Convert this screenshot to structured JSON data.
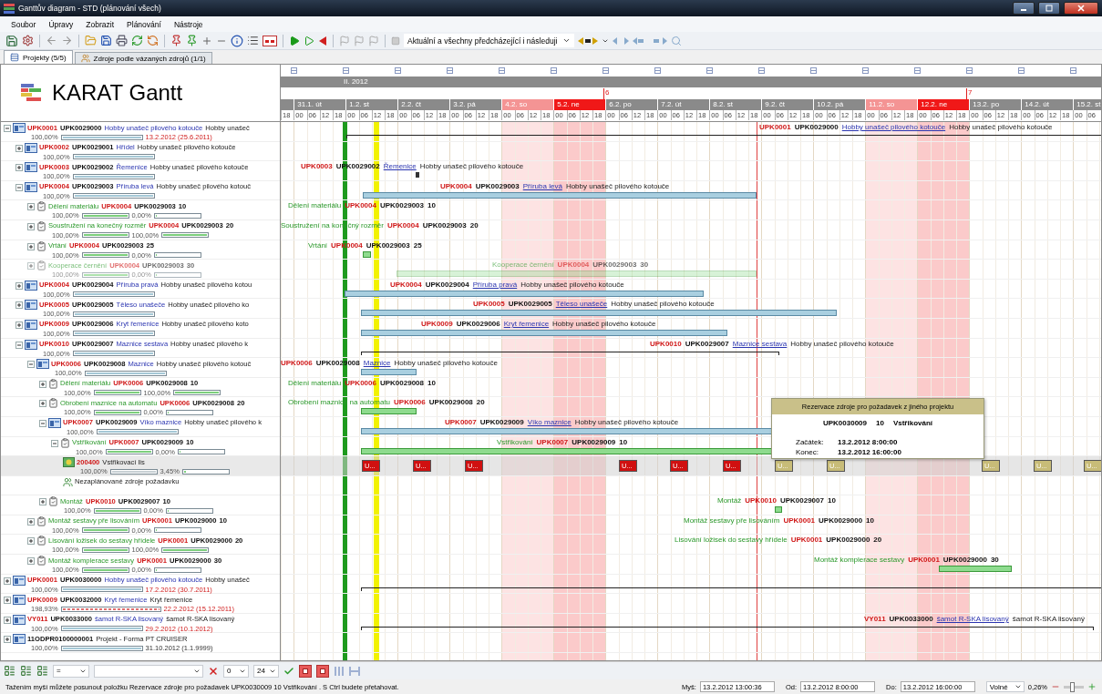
{
  "window": {
    "title": "Ganttův diagram - STD (plánování všech)"
  },
  "menu": [
    "Soubor",
    "Úpravy",
    "Zobrazit",
    "Plánování",
    "Nástroje"
  ],
  "toolbar": {
    "filter": "Aktuální a všechny předcházející i následuji"
  },
  "tabs": [
    {
      "label": "Projekty (5/5)",
      "selected": true
    },
    {
      "label": "Zdroje podle vázaných zdrojů (1/1)",
      "selected": false
    }
  ],
  "header": {
    "title": "KARAT Gantt"
  },
  "timeline": {
    "lead_hours": [
      "18"
    ],
    "month": {
      "label": "II. 2012"
    },
    "weeks": [
      {
        "label": "6"
      },
      {
        "label": "7"
      }
    ],
    "days": [
      {
        "label": "31.1. út",
        "kind": "work",
        "hours": [
          "00",
          "06",
          "12",
          "18"
        ]
      },
      {
        "label": "1.2. st",
        "kind": "work",
        "hours": [
          "00",
          "06",
          "12",
          "18"
        ]
      },
      {
        "label": "2.2. čt",
        "kind": "work",
        "hours": [
          "00",
          "06",
          "12",
          "18"
        ]
      },
      {
        "label": "3.2. pá",
        "kind": "work",
        "hours": [
          "00",
          "06",
          "12",
          "18"
        ]
      },
      {
        "label": "4.2. so",
        "kind": "saturday",
        "hours": [
          "00",
          "06",
          "12",
          "18"
        ]
      },
      {
        "label": "5.2. ne",
        "kind": "sunday",
        "hours": [
          "00",
          "06",
          "12",
          "18"
        ]
      },
      {
        "label": "6.2. po",
        "kind": "work",
        "hours": [
          "00",
          "06",
          "12",
          "18"
        ]
      },
      {
        "label": "7.2. út",
        "kind": "work",
        "hours": [
          "00",
          "06",
          "12",
          "18"
        ]
      },
      {
        "label": "8.2. st",
        "kind": "work",
        "hours": [
          "00",
          "06",
          "12",
          "18"
        ]
      },
      {
        "label": "9.2. čt",
        "kind": "work",
        "hours": [
          "00",
          "06",
          "12",
          "18"
        ]
      },
      {
        "label": "10.2. pá",
        "kind": "work",
        "hours": [
          "00",
          "06",
          "12",
          "18"
        ]
      },
      {
        "label": "11.2. so",
        "kind": "saturday",
        "hours": [
          "00",
          "06",
          "12",
          "18"
        ]
      },
      {
        "label": "12.2. ne",
        "kind": "sunday",
        "hours": [
          "00",
          "06",
          "12",
          "18"
        ]
      },
      {
        "label": "13.2. po",
        "kind": "work",
        "hours": [
          "00",
          "06",
          "12",
          "18"
        ]
      },
      {
        "label": "14.2. út",
        "kind": "work",
        "hours": [
          "00",
          "06",
          "12",
          "18"
        ]
      },
      {
        "label": "15.2. st",
        "kind": "work",
        "hours": [
          "00",
          "06"
        ]
      }
    ],
    "markers": [
      {
        "color": "#1e9a1e"
      },
      {
        "color": "#f2f200"
      },
      {
        "color": "#e04040"
      }
    ]
  },
  "tree": [
    {
      "kind": "project",
      "expanded": true,
      "parts": [
        {
          "kind": "code",
          "text": "UPK0001"
        },
        {
          "kind": "order",
          "text": "UPK0029000"
        },
        {
          "kind": "name",
          "text": "Hobby unašeč pilového kotouče"
        },
        {
          "kind": "desc",
          "text": "Hobby unašeč"
        }
      ],
      "progress": [
        {
          "reading": "100,00%",
          "level": 1
        }
      ],
      "date": "13.2.2012 (25.6.2011)",
      "overdue": true,
      "gantt": {
        "label": [
          {
            "kind": "code",
            "text": "UPK0001"
          },
          {
            "kind": "order",
            "text": "UPK0029000"
          },
          {
            "kind": "name",
            "text": "Hobby unašeč pilového kotouče"
          },
          {
            "kind": "desc",
            "text": "Hobby unašeč pilového kotouče"
          }
        ],
        "bar": {
          "kind": "summary"
        }
      },
      "children": [
        {
          "kind": "project",
          "expanded": false,
          "parts": [
            {
              "kind": "code",
              "text": "UPK0002"
            },
            {
              "kind": "order",
              "text": "UPK0029001"
            },
            {
              "kind": "name",
              "text": "Hřídel"
            },
            {
              "kind": "desc",
              "text": "Hobby unašeč pilového kotouče"
            }
          ],
          "progress": [
            {
              "reading": "100,00%",
              "level": 1
            }
          ]
        },
        {
          "kind": "project",
          "expanded": false,
          "parts": [
            {
              "kind": "code",
              "text": "UPK0003"
            },
            {
              "kind": "order",
              "text": "UPK0029002"
            },
            {
              "kind": "name",
              "text": "Řemenice"
            },
            {
              "kind": "desc",
              "text": "Hobby unašeč pilového kotouče"
            }
          ],
          "progress": [
            {
              "reading": "100,00%",
              "level": 1
            }
          ],
          "gantt": {
            "label": [
              {
                "kind": "code",
                "text": "UPK0003"
              },
              {
                "kind": "order",
                "text": "UPK0029002"
              },
              {
                "kind": "name",
                "text": "Řemenice"
              },
              {
                "kind": "desc",
                "text": "Hobby unašeč pilového kotouče"
              }
            ],
            "bar": {
              "kind": "tick"
            }
          }
        },
        {
          "kind": "project",
          "expanded": true,
          "parts": [
            {
              "kind": "code",
              "text": "UPK0004"
            },
            {
              "kind": "order",
              "text": "UPK0029003"
            },
            {
              "kind": "name",
              "text": "Příruba levá"
            },
            {
              "kind": "desc",
              "text": "Hobby unašeč pilového kotouč"
            }
          ],
          "progress": [
            {
              "reading": "100,00%",
              "level": 1
            }
          ],
          "gantt": {
            "label": [
              {
                "kind": "code",
                "text": "UPK0004"
              },
              {
                "kind": "order",
                "text": "UPK0029003"
              },
              {
                "kind": "name",
                "text": "Příruba levá"
              },
              {
                "kind": "desc",
                "text": "Hobby unašeč pilového kotouče"
              }
            ],
            "bar": {
              "kind": "project"
            }
          },
          "children": [
            {
              "kind": "operation",
              "expanded": false,
              "disabled": false,
              "parts": [
                {
                  "kind": "op",
                  "text": "Dělení materiálu"
                },
                {
                  "kind": "code",
                  "text": "UPK0004"
                },
                {
                  "kind": "order",
                  "text": "UPK0029003"
                },
                {
                  "kind": "step",
                  "text": "10"
                }
              ],
              "progress": [
                {
                  "reading": "100,00%",
                  "level": 1
                },
                {
                  "reading": "0,00%",
                  "level": 0
                }
              ],
              "gantt": {
                "label": [
                  {
                    "kind": "op",
                    "text": "Dělení materiálu"
                  },
                  {
                    "kind": "code",
                    "text": "UPK0004"
                  },
                  {
                    "kind": "order",
                    "text": "UPK0029003"
                  },
                  {
                    "kind": "step",
                    "text": "10"
                  }
                ]
              }
            },
            {
              "kind": "operation",
              "expanded": false,
              "disabled": false,
              "parts": [
                {
                  "kind": "op",
                  "text": "Soustružení na konečný rozměr"
                },
                {
                  "kind": "code",
                  "text": "UPK0004"
                },
                {
                  "kind": "order",
                  "text": "UPK0029003"
                },
                {
                  "kind": "step",
                  "text": "20"
                }
              ],
              "progress": [
                {
                  "reading": "100,00%",
                  "level": 1
                },
                {
                  "reading": "100,00%",
                  "level": 1
                }
              ],
              "gantt": {
                "label": [
                  {
                    "kind": "op",
                    "text": "Soustružení na konečný rozměr"
                  },
                  {
                    "kind": "code",
                    "text": "UPK0004"
                  },
                  {
                    "kind": "order",
                    "text": "UPK0029003"
                  },
                  {
                    "kind": "step",
                    "text": "20"
                  }
                ]
              }
            },
            {
              "kind": "operation",
              "expanded": false,
              "disabled": false,
              "parts": [
                {
                  "kind": "op",
                  "text": "Vrtání"
                },
                {
                  "kind": "code",
                  "text": "UPK0004"
                },
                {
                  "kind": "order",
                  "text": "UPK0029003"
                },
                {
                  "kind": "step",
                  "text": "25"
                }
              ],
              "progress": [
                {
                  "reading": "100,00%",
                  "level": 1
                },
                {
                  "reading": "0,00%",
                  "level": 0
                }
              ],
              "gantt": {
                "label": [
                  {
                    "kind": "op",
                    "text": "Vrtání"
                  },
                  {
                    "kind": "code",
                    "text": "UPK0004"
                  },
                  {
                    "kind": "order",
                    "text": "UPK0029003"
                  },
                  {
                    "kind": "step",
                    "text": "25"
                  }
                ],
                "bar": {
                  "kind": "operation"
                }
              }
            },
            {
              "kind": "operation",
              "expanded": false,
              "disabled": true,
              "parts": [
                {
                  "kind": "op",
                  "text": "Kooperace černění"
                },
                {
                  "kind": "code",
                  "text": "UPK0004"
                },
                {
                  "kind": "order",
                  "text": "UPK0029003"
                },
                {
                  "kind": "step",
                  "text": "30"
                }
              ],
              "progress": [
                {
                  "reading": "100,00%",
                  "level": 1
                },
                {
                  "reading": "0,00%",
                  "level": 0
                }
              ],
              "gantt": {
                "label": [
                  {
                    "kind": "op",
                    "text": "Kooperace černění"
                  },
                  {
                    "kind": "code",
                    "text": "UPK0004"
                  },
                  {
                    "kind": "order",
                    "text": "UPK0029003"
                  },
                  {
                    "kind": "step",
                    "text": "30"
                  }
                ],
                "bar": {
                  "kind": "operation"
                }
              }
            }
          ]
        },
        {
          "kind": "project",
          "expanded": false,
          "parts": [
            {
              "kind": "code",
              "text": "UPK0004"
            },
            {
              "kind": "order",
              "text": "UPK0029004"
            },
            {
              "kind": "name",
              "text": "Příruba pravá"
            },
            {
              "kind": "desc",
              "text": "Hobby unašeč pilového kotou"
            }
          ],
          "progress": [
            {
              "reading": "100,00%",
              "level": 1
            }
          ],
          "gantt": {
            "label": [
              {
                "kind": "code",
                "text": "UPK0004"
              },
              {
                "kind": "order",
                "text": "UPK0029004"
              },
              {
                "kind": "name",
                "text": "Příruba pravá"
              },
              {
                "kind": "desc",
                "text": "Hobby unašeč pilového kotouče"
              }
            ],
            "bar": {
              "kind": "project"
            }
          }
        },
        {
          "kind": "project",
          "expanded": false,
          "parts": [
            {
              "kind": "code",
              "text": "UPK0005"
            },
            {
              "kind": "order",
              "text": "UPK0029005"
            },
            {
              "kind": "name",
              "text": "Těleso unašeče"
            },
            {
              "kind": "desc",
              "text": "Hobby unašeč pilového ko"
            }
          ],
          "progress": [
            {
              "reading": "100,00%",
              "level": 1
            }
          ],
          "gantt": {
            "label": [
              {
                "kind": "code",
                "text": "UPK0005"
              },
              {
                "kind": "order",
                "text": "UPK0029005"
              },
              {
                "kind": "name",
                "text": "Těleso unašeče"
              },
              {
                "kind": "desc",
                "text": "Hobby unašeč pilového kotouče"
              }
            ],
            "bar": {
              "kind": "project"
            }
          }
        },
        {
          "kind": "project",
          "expanded": false,
          "parts": [
            {
              "kind": "code",
              "text": "UPK0009"
            },
            {
              "kind": "order",
              "text": "UPK0029006"
            },
            {
              "kind": "name",
              "text": "Kryt řemenice"
            },
            {
              "kind": "desc",
              "text": "Hobby unašeč pilového koto"
            }
          ],
          "progress": [
            {
              "reading": "100,00%",
              "level": 1
            }
          ],
          "gantt": {
            "label": [
              {
                "kind": "code",
                "text": "UPK0009"
              },
              {
                "kind": "order",
                "text": "UPK0029006"
              },
              {
                "kind": "name",
                "text": "Kryt řemenice"
              },
              {
                "kind": "desc",
                "text": "Hobby unašeč pilového kotouče"
              }
            ],
            "bar": {
              "kind": "project"
            }
          }
        },
        {
          "kind": "project",
          "expanded": true,
          "parts": [
            {
              "kind": "code",
              "text": "UPK0010"
            },
            {
              "kind": "order",
              "text": "UPK0029007"
            },
            {
              "kind": "name",
              "text": "Maznice sestava"
            },
            {
              "kind": "desc",
              "text": "Hobby unašeč pilového k"
            }
          ],
          "progress": [
            {
              "reading": "100,00%",
              "level": 1
            }
          ],
          "gantt": {
            "label": [
              {
                "kind": "code",
                "text": "UPK0010"
              },
              {
                "kind": "order",
                "text": "UPK0029007"
              },
              {
                "kind": "name",
                "text": "Maznice sestava"
              },
              {
                "kind": "desc",
                "text": "Hobby unašeč pilového kotouče"
              }
            ],
            "bar": {
              "kind": "summary"
            }
          },
          "children": [
            {
              "kind": "project",
              "expanded": true,
              "parts": [
                {
                  "kind": "code",
                  "text": "UPK0006"
                },
                {
                  "kind": "order",
                  "text": "UPK0029008"
                },
                {
                  "kind": "name",
                  "text": "Maznice"
                },
                {
                  "kind": "desc",
                  "text": "Hobby unašeč pilového kotouč"
                }
              ],
              "progress": [
                {
                  "reading": "100,00%",
                  "level": 1
                }
              ],
              "gantt": {
                "label": [
                  {
                    "kind": "code",
                    "text": "UPK0006"
                  },
                  {
                    "kind": "order",
                    "text": "UPK0029008"
                  },
                  {
                    "kind": "name",
                    "text": "Maznice"
                  },
                  {
                    "kind": "desc",
                    "text": "Hobby unašeč pilového kotouče"
                  }
                ],
                "bar": {
                  "kind": "project"
                }
              },
              "children": [
                {
                  "kind": "operation",
                  "expanded": false,
                  "disabled": false,
                  "parts": [
                    {
                      "kind": "op",
                      "text": "Dělení materiálu"
                    },
                    {
                      "kind": "code",
                      "text": "UPK0006"
                    },
                    {
                      "kind": "order",
                      "text": "UPK0029008"
                    },
                    {
                      "kind": "step",
                      "text": "10"
                    }
                  ],
                  "progress": [
                    {
                      "reading": "100,00%",
                      "level": 1
                    },
                    {
                      "reading": "100,00%",
                      "level": 1
                    }
                  ],
                  "gantt": {
                    "label": [
                      {
                        "kind": "op",
                        "text": "Dělení materiálu"
                      },
                      {
                        "kind": "code",
                        "text": "UPK0006"
                      },
                      {
                        "kind": "order",
                        "text": "UPK0029008"
                      },
                      {
                        "kind": "step",
                        "text": "10"
                      }
                    ]
                  }
                },
                {
                  "kind": "operation",
                  "expanded": false,
                  "disabled": false,
                  "parts": [
                    {
                      "kind": "op",
                      "text": "Obrobení maznice na automatu"
                    },
                    {
                      "kind": "code",
                      "text": "UPK0006"
                    },
                    {
                      "kind": "order",
                      "text": "UPK0029008"
                    },
                    {
                      "kind": "step",
                      "text": "20"
                    }
                  ],
                  "progress": [
                    {
                      "reading": "100,00%",
                      "level": 1
                    },
                    {
                      "reading": "0,00%",
                      "level": 0
                    }
                  ],
                  "gantt": {
                    "label": [
                      {
                        "kind": "op",
                        "text": "Obrobení maznice na automatu"
                      },
                      {
                        "kind": "code",
                        "text": "UPK0006"
                      },
                      {
                        "kind": "order",
                        "text": "UPK0029008"
                      },
                      {
                        "kind": "step",
                        "text": "20"
                      }
                    ],
                    "bar": {
                      "kind": "operation"
                    }
                  }
                },
                {
                  "kind": "project",
                  "expanded": true,
                  "parts": [
                    {
                      "kind": "code",
                      "text": "UPK0007"
                    },
                    {
                      "kind": "order",
                      "text": "UPK0029009"
                    },
                    {
                      "kind": "name",
                      "text": "Víko maznice"
                    },
                    {
                      "kind": "desc",
                      "text": "Hobby unašeč pilového k"
                    }
                  ],
                  "progress": [
                    {
                      "reading": "100,00%",
                      "level": 1
                    }
                  ],
                  "gantt": {
                    "label": [
                      {
                        "kind": "code",
                        "text": "UPK0007"
                      },
                      {
                        "kind": "order",
                        "text": "UPK0029009"
                      },
                      {
                        "kind": "name",
                        "text": "Víko maznice"
                      },
                      {
                        "kind": "desc",
                        "text": "Hobby unašeč pilového kotouče"
                      }
                    ],
                    "bar": {
                      "kind": "project"
                    }
                  },
                  "children": [
                    {
                      "kind": "operation",
                      "expanded": true,
                      "disabled": false,
                      "parts": [
                        {
                          "kind": "op",
                          "text": "Vstřikování"
                        },
                        {
                          "kind": "code",
                          "text": "UPK0007"
                        },
                        {
                          "kind": "order",
                          "text": "UPK0029009"
                        },
                        {
                          "kind": "step",
                          "text": "10"
                        }
                      ],
                      "progress": [
                        {
                          "reading": "100,00%",
                          "level": 1
                        },
                        {
                          "reading": "0,00%",
                          "level": 0
                        }
                      ],
                      "gantt": {
                        "label": [
                          {
                            "kind": "op",
                            "text": "Vstřikování"
                          },
                          {
                            "kind": "code",
                            "text": "UPK0007"
                          },
                          {
                            "kind": "order",
                            "text": "UPK0029009"
                          },
                          {
                            "kind": "step",
                            "text": "10"
                          }
                        ],
                        "bar": {
                          "kind": "operation"
                        }
                      },
                      "children": [
                        {
                          "kind": "resource",
                          "parts": [
                            {
                              "kind": "code",
                              "text": "200400"
                            },
                            {
                              "kind": "desc",
                              "text": "Vstřikovací lis"
                            }
                          ],
                          "progress": [
                            {
                              "reading": "100,00%",
                              "level": 1
                            },
                            {
                              "reading": "3,45%",
                              "level": 0.0345
                            }
                          ],
                          "gantt": {
                            "blocks": [
                              {
                                "label": "U...",
                                "color": "#d01010"
                              },
                              {
                                "label": "U...",
                                "color": "#d01010"
                              },
                              {
                                "label": "U...",
                                "color": "#d01010"
                              },
                              {
                                "label": "U...",
                                "color": "#d01010"
                              },
                              {
                                "label": "U...",
                                "color": "#d01010"
                              },
                              {
                                "label": "U...",
                                "color": "#d01010"
                              },
                              {
                                "label": "U...",
                                "color": "#c8bc78"
                              },
                              {
                                "label": "U...",
                                "color": "#c8bc78"
                              },
                              {
                                "label": "U...",
                                "color": "#c8bc78"
                              },
                              {
                                "label": "U...",
                                "color": "#c8bc78"
                              },
                              {
                                "label": "U...",
                                "color": "#c8bc78"
                              }
                            ]
                          }
                        },
                        {
                          "kind": "unplanned",
                          "parts": [
                            {
                              "kind": "desc",
                              "text": "Nezaplánované zdroje požadavku"
                            }
                          ]
                        }
                      ]
                    }
                  ]
                },
                {
                  "kind": "operation",
                  "expanded": false,
                  "disabled": false,
                  "parts": [
                    {
                      "kind": "op",
                      "text": "Montáž"
                    },
                    {
                      "kind": "code",
                      "text": "UPK0010"
                    },
                    {
                      "kind": "order",
                      "text": "UPK0029007"
                    },
                    {
                      "kind": "step",
                      "text": "10"
                    }
                  ],
                  "progress": [
                    {
                      "reading": "100,00%",
                      "level": 1
                    },
                    {
                      "reading": "0,00%",
                      "level": 0
                    }
                  ],
                  "gantt": {
                    "label": [
                      {
                        "kind": "op",
                        "text": "Montáž"
                      },
                      {
                        "kind": "code",
                        "text": "UPK0010"
                      },
                      {
                        "kind": "order",
                        "text": "UPK0029007"
                      },
                      {
                        "kind": "step",
                        "text": "10"
                      }
                    ],
                    "bar": {
                      "kind": "operation"
                    }
                  }
                }
              ]
            },
            {
              "kind": "operation",
              "expanded": false,
              "disabled": false,
              "parts": [
                {
                  "kind": "op",
                  "text": "Montáž sestavy pře lisováním"
                },
                {
                  "kind": "code",
                  "text": "UPK0001"
                },
                {
                  "kind": "order",
                  "text": "UPK0029000"
                },
                {
                  "kind": "step",
                  "text": "10"
                }
              ],
              "progress": [
                {
                  "reading": "100,00%",
                  "level": 1
                },
                {
                  "reading": "0,00%",
                  "level": 0
                }
              ],
              "gantt": {
                "label": [
                  {
                    "kind": "op",
                    "text": "Montáž sestavy pře lisováním"
                  },
                  {
                    "kind": "code",
                    "text": "UPK0001"
                  },
                  {
                    "kind": "order",
                    "text": "UPK0029000"
                  },
                  {
                    "kind": "step",
                    "text": "10"
                  }
                ]
              }
            },
            {
              "kind": "operation",
              "expanded": false,
              "disabled": false,
              "parts": [
                {
                  "kind": "op",
                  "text": "Lisování ložisek do sestavy hřídele"
                },
                {
                  "kind": "code",
                  "text": "UPK0001"
                },
                {
                  "kind": "order",
                  "text": "UPK0029000"
                },
                {
                  "kind": "step",
                  "text": "20"
                }
              ],
              "progress": [
                {
                  "reading": "100,00%",
                  "level": 1
                },
                {
                  "reading": "100,00%",
                  "level": 1
                }
              ],
              "gantt": {
                "label": [
                  {
                    "kind": "op",
                    "text": "Lisování ložisek do sestavy hřídele"
                  },
                  {
                    "kind": "code",
                    "text": "UPK0001"
                  },
                  {
                    "kind": "order",
                    "text": "UPK0029000"
                  },
                  {
                    "kind": "step",
                    "text": "20"
                  }
                ]
              }
            },
            {
              "kind": "operation",
              "expanded": false,
              "disabled": false,
              "parts": [
                {
                  "kind": "op",
                  "text": "Montáž komplerace sestavy"
                },
                {
                  "kind": "code",
                  "text": "UPK0001"
                },
                {
                  "kind": "order",
                  "text": "UPK0029000"
                },
                {
                  "kind": "step",
                  "text": "30"
                }
              ],
              "progress": [
                {
                  "reading": "100,00%",
                  "level": 1
                },
                {
                  "reading": "0,00%",
                  "level": 0
                }
              ],
              "gantt": {
                "label": [
                  {
                    "kind": "op",
                    "text": "Montáž komplerace sestavy"
                  },
                  {
                    "kind": "code",
                    "text": "UPK0001"
                  },
                  {
                    "kind": "order",
                    "text": "UPK0029000"
                  },
                  {
                    "kind": "step",
                    "text": "30"
                  }
                ],
                "bar": {
                  "kind": "operation"
                }
              }
            }
          ]
        }
      ]
    },
    {
      "kind": "project",
      "expanded": false,
      "parts": [
        {
          "kind": "code",
          "text": "UPK0001"
        },
        {
          "kind": "order",
          "text": "UPK0030000"
        },
        {
          "kind": "name",
          "text": "Hobby unašeč pilového kotouče"
        },
        {
          "kind": "desc",
          "text": "Hobby unašeč"
        }
      ],
      "progress": [
        {
          "reading": "100,00%",
          "level": 1
        }
      ],
      "date": "17.2.2012 (30.7.2011)",
      "overdue": true,
      "gantt": {
        "bar": {
          "kind": "summary"
        }
      }
    },
    {
      "kind": "project",
      "expanded": false,
      "parts": [
        {
          "kind": "code",
          "text": "UPK0009"
        },
        {
          "kind": "order",
          "text": "UPK0032000"
        },
        {
          "kind": "name",
          "text": "Kryt řemenice"
        },
        {
          "kind": "desc",
          "text": "Kryt řemenice"
        }
      ],
      "progress": [
        {
          "reading": "198,93%",
          "level": 1,
          "overrun": true
        }
      ],
      "date": "22.2.2012 (15.12.2011)",
      "overdue": true
    },
    {
      "kind": "project",
      "expanded": false,
      "parts": [
        {
          "kind": "code",
          "text": "VY011"
        },
        {
          "kind": "order",
          "text": "UPK0033000"
        },
        {
          "kind": "name",
          "text": "šamot R-SKA lisovaný"
        },
        {
          "kind": "desc",
          "text": "šamot R-SKA lisovaný"
        }
      ],
      "progress": [
        {
          "reading": "100,00%",
          "level": 1
        }
      ],
      "date": "29.2.2012 (10.1.2012)",
      "overdue": true,
      "gantt": {
        "label": [
          {
            "kind": "code",
            "text": "VY011"
          },
          {
            "kind": "order",
            "text": "UPK0033000"
          },
          {
            "kind": "name",
            "text": "šamot R-SKA lisovaný"
          },
          {
            "kind": "desc",
            "text": "šamot R-SKA lisovaný"
          }
        ],
        "bar": {
          "kind": "summary"
        }
      }
    },
    {
      "kind": "project",
      "expanded": false,
      "parts": [
        {
          "kind": "order",
          "text": "11ODPR0100000001"
        },
        {
          "kind": "desc",
          "text": "Projekt - Forma PT CRUISER"
        }
      ],
      "progress": [
        {
          "reading": "100,00%",
          "level": 1
        }
      ],
      "date": "31.10.2012 (1.1.9999)",
      "overdue": false
    }
  ],
  "tooltip": {
    "title": "Rezervace zdroje pro požadavek z jiného projektu",
    "code": "UPK0030009",
    "step": "10",
    "operation": "Vstřikování",
    "rows": [
      {
        "label": "Začátek:",
        "value": "13.2.2012 8:00:00"
      },
      {
        "label": "Konec:",
        "value": "13.2.2012 16:00:00"
      }
    ]
  },
  "bottom_toolbar": {
    "operator": "=",
    "hour_from": "0",
    "hour_to": "24",
    "toggles": [
      {
        "on": true
      },
      {
        "on": true
      }
    ]
  },
  "status": {
    "message": "Tažením myší můžete posunout položku Rezervace zdroje pro požadavek UPK0030009  10  Vstřikování . S Ctrl budete přetahovat.",
    "fields": [
      {
        "label": "Myš:",
        "value": "13.2.2012 13:00:36"
      },
      {
        "label": "Od:",
        "value": "13.2.2012 8:00:00"
      },
      {
        "label": "Do:",
        "value": "13.2.2012 16:00:00"
      }
    ],
    "mode": "Volné",
    "zoom_reading": "0,26%",
    "zoom": {
      "level": 0.4
    }
  }
}
